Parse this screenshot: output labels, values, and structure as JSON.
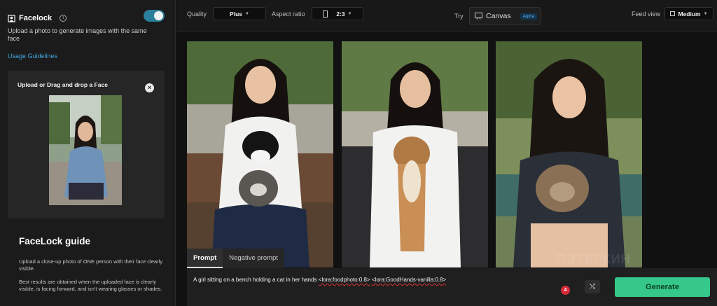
{
  "sidebar": {
    "title": "Facelock",
    "info_icon": "info-icon",
    "toggle_on": true,
    "description": "Upload a photo to generate images with the same face",
    "usage_link": "Usage Guidelines",
    "upload": {
      "title": "Upload or Drag and drop a Face",
      "close_icon": "close-icon",
      "close_glyph": "×"
    },
    "guide": {
      "title": "FaceLock guide",
      "paragraph1": "Upload a close-up photo of ONE person with their face clearly visible.",
      "paragraph2": "Best results are obtained when the uploaded face is clearly visible, is facing forward, and isn't wearing glasses or shades."
    }
  },
  "topbar": {
    "quality_label": "Quality",
    "quality_value": "Plus",
    "aspect_label": "Aspect ratio",
    "aspect_value": "2:3",
    "try_label": "Try",
    "canvas_label": "Canvas",
    "canvas_badge": "Alpha",
    "feed_label": "Feed view",
    "feed_value": "Medium"
  },
  "prompt": {
    "tabs": [
      "Prompt",
      "Negative prompt"
    ],
    "text_main": "A girl sitting on a bench holding a cat in her hands ",
    "lora1": "<lora:foodphoto:0.8>",
    "lora2": "<lora:GoodHands-vanilla:0.8>",
    "badge_count": "4",
    "shuffle_icon": "shuffle-icon",
    "generate_label": "Generate"
  },
  "watermark": "ПЭТЕРКИН",
  "colors": {
    "accent_green": "#35c88a",
    "link_blue": "#41a6e0",
    "toggle_blue": "#2b7f9a",
    "badge_red": "#d62b3a"
  }
}
